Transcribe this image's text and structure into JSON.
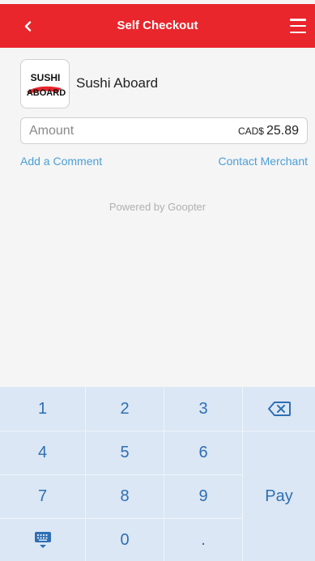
{
  "header": {
    "title": "Self Checkout",
    "back_icon": "chevron-left-icon",
    "menu_icon": "hamburger-menu-icon"
  },
  "merchant": {
    "name": "Sushi Aboard",
    "logo_text_top": "SUSHI",
    "logo_text_bottom": "ABOARD"
  },
  "amount": {
    "placeholder": "Amount",
    "currency": "CAD$",
    "value": "25.89"
  },
  "links": {
    "add_comment": "Add a Comment",
    "contact_merchant": "Contact Merchant"
  },
  "footer": {
    "powered_by": "Powered by Goopter"
  },
  "keypad": {
    "keys": [
      "1",
      "2",
      "3",
      "4",
      "5",
      "6",
      "7",
      "8",
      "9",
      "0",
      "."
    ],
    "pay_label": "Pay",
    "backspace_icon": "backspace-icon",
    "keyboard_icon": "keyboard-icon"
  },
  "colors": {
    "brand": "#e8262c",
    "link": "#4a9fd8",
    "keypad_bg": "#dbe7f4",
    "key_text": "#2e6fb4"
  }
}
